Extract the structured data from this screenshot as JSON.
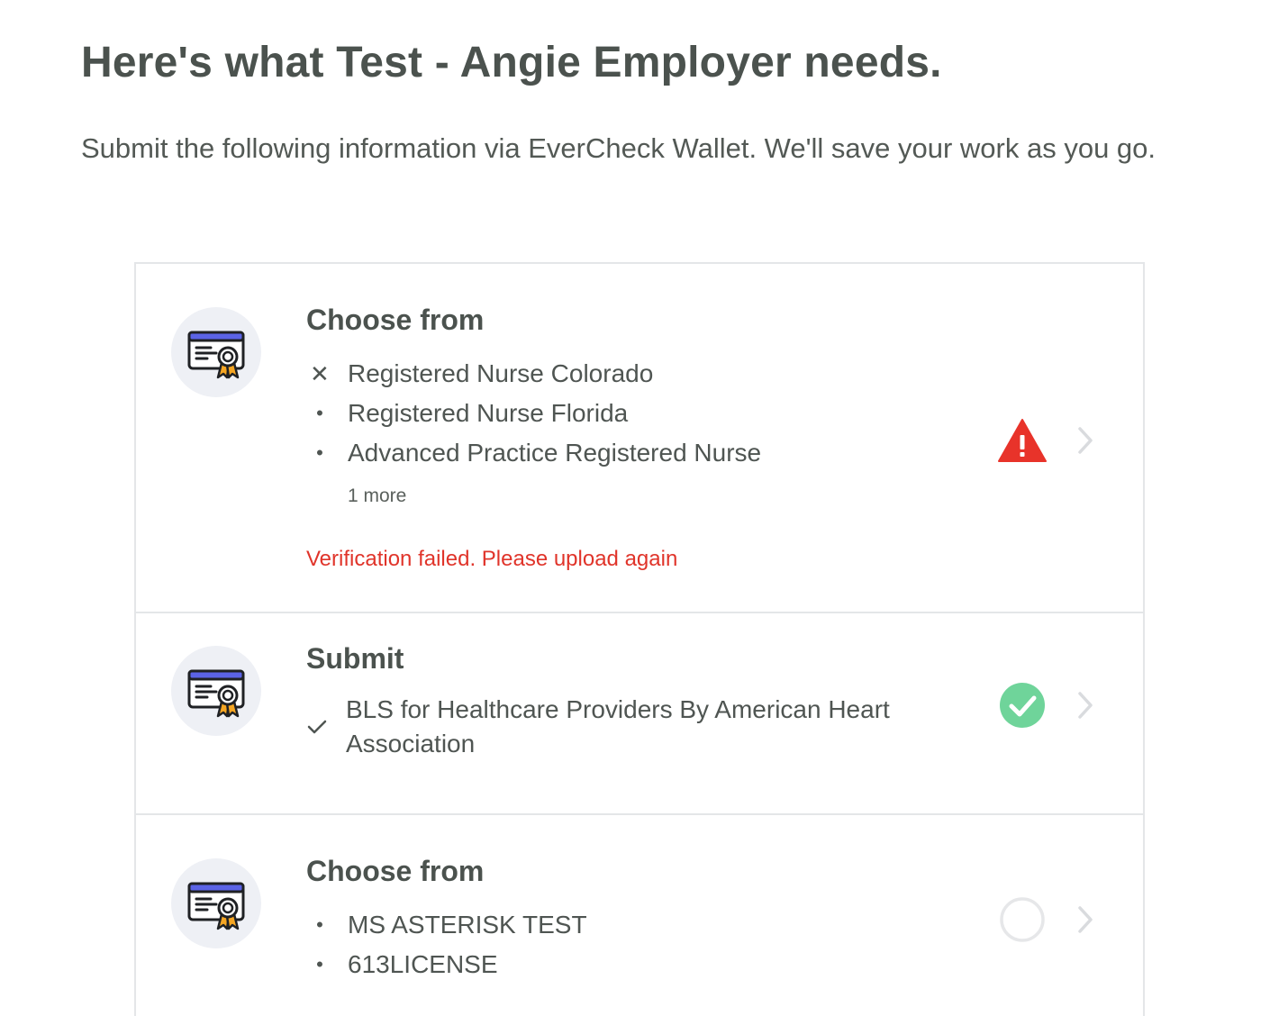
{
  "header": {
    "title": "Here's what Test - Angie Employer needs.",
    "subtitle": "Submit the following information via EverCheck Wallet. We'll save your work as you go."
  },
  "requirements": [
    {
      "title": "Choose from",
      "icon": "certificate-icon",
      "items": [
        {
          "label": "Registered Nurse Colorado",
          "marker": "x"
        },
        {
          "label": "Registered Nurse Florida",
          "marker": "bullet"
        },
        {
          "label": "Advanced Practice Registered Nurse",
          "marker": "bullet"
        }
      ],
      "more": "1 more",
      "error": "Verification failed. Please upload again",
      "status": "warning-icon",
      "status_color": "#e8332a"
    },
    {
      "title": "Submit",
      "icon": "certificate-icon",
      "items": [
        {
          "label": "BLS for Healthcare Providers By American Heart Association",
          "marker": "check"
        }
      ],
      "status": "check-circle-icon",
      "status_color": "#6fd49a"
    },
    {
      "title": "Choose from",
      "icon": "certificate-icon",
      "items": [
        {
          "label": "MS ASTERISK TEST",
          "marker": "bullet"
        },
        {
          "label": "613LICENSE",
          "marker": "bullet"
        }
      ],
      "status": "empty-circle-icon",
      "status_color": "#e6e7e9"
    }
  ],
  "colors": {
    "title_text": "#4b524e",
    "error_text": "#e0342a",
    "card_border": "#e4e6e8",
    "icon_bg": "#eef0f5",
    "certificate_header": "#5b63e6",
    "ribbon": "#f5a623"
  }
}
